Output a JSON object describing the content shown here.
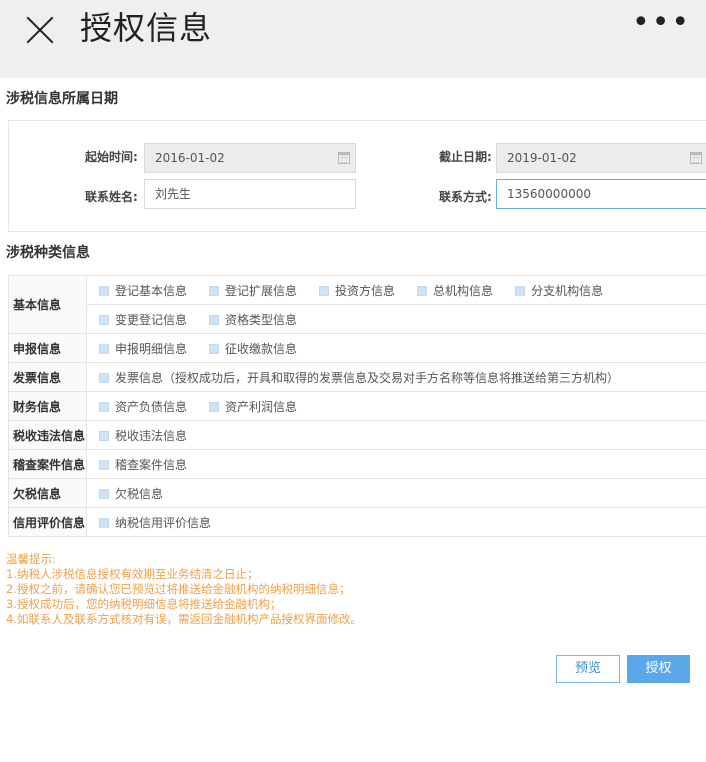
{
  "topbar": {
    "title": "授权信息",
    "close_icon": "close-icon",
    "more_icon": "more-dots-icon",
    "more_text": "•••"
  },
  "date_section": {
    "title": "涉税信息所属日期",
    "start_label": "起始时间:",
    "start_value": "2016-01-02",
    "end_label": "截止日期:",
    "end_value": "2019-01-02",
    "name_label": "联系姓名:",
    "name_value": "刘先生",
    "contact_label": "联系方式:",
    "contact_value": "13560000000"
  },
  "tax_section": {
    "title": "涉税种类信息",
    "rows": [
      {
        "category": "基本信息",
        "lines": [
          [
            "登记基本信息",
            "登记扩展信息",
            "投资方信息",
            "总机构信息",
            "分支机构信息"
          ],
          [
            "变更登记信息",
            "资格类型信息"
          ]
        ]
      },
      {
        "category": "申报信息",
        "lines": [
          [
            "申报明细信息",
            "征收缴款信息"
          ]
        ]
      },
      {
        "category": "发票信息",
        "lines": [
          [
            "发票信息（授权成功后，开具和取得的发票信息及交易对手方名称等信息将推送给第三方机构）"
          ]
        ]
      },
      {
        "category": "财务信息",
        "lines": [
          [
            "资产负债信息",
            "资产利润信息"
          ]
        ]
      },
      {
        "category": "税收违法信息",
        "lines": [
          [
            "税收违法信息"
          ]
        ]
      },
      {
        "category": "稽查案件信息",
        "lines": [
          [
            "稽查案件信息"
          ]
        ]
      },
      {
        "category": "欠税信息",
        "lines": [
          [
            "欠税信息"
          ]
        ]
      },
      {
        "category": "信用评价信息",
        "lines": [
          [
            "纳税信用评价信息"
          ]
        ]
      }
    ]
  },
  "notice": {
    "title": "温馨提示:",
    "items": [
      "1.纳税人涉税信息授权有效期至业务结清之日止；",
      "2.授权之前，请确认您已预览过将推送给金融机构的纳税明细信息；",
      "3.授权成功后，您的纳税明细信息将推送给金融机构；",
      "4.如联系人及联系方式核对有误，需返回金融机构产品授权界面修改。"
    ]
  },
  "buttons": {
    "preview": "预览",
    "authorize": "授权"
  },
  "colors": {
    "accent": "#5aa7ea",
    "notice": "#f0a04b",
    "checkbox": "#cfe3f5"
  }
}
